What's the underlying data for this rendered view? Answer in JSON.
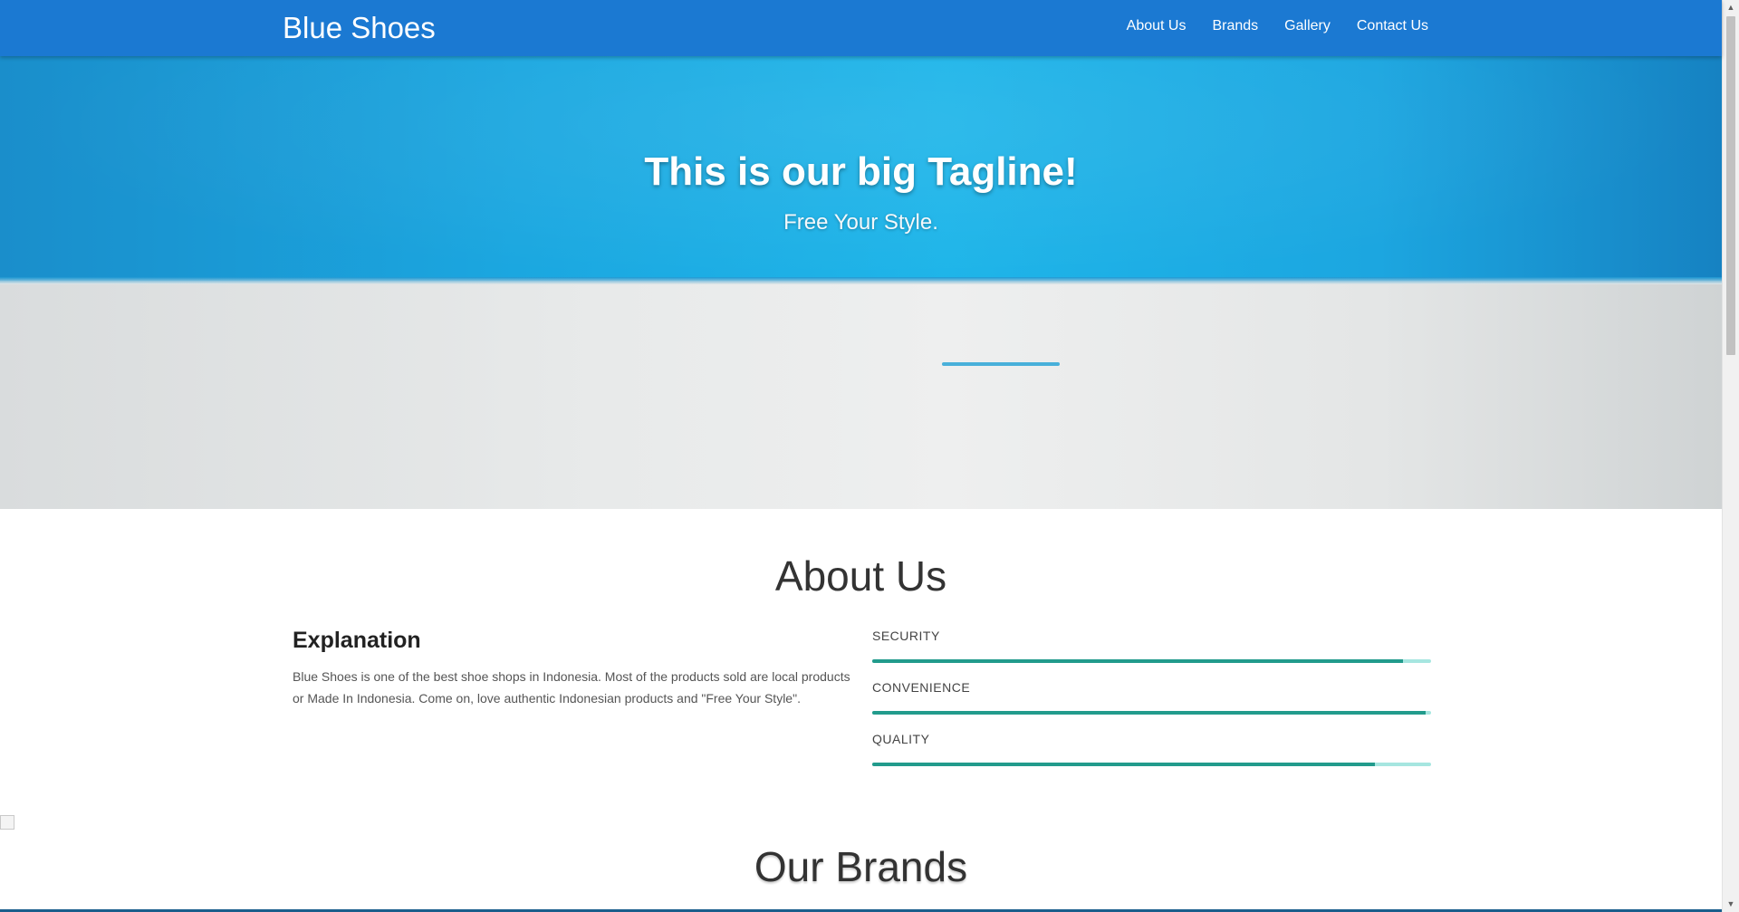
{
  "navbar": {
    "brand": "Blue Shoes",
    "links": [
      "About Us",
      "Brands",
      "Gallery",
      "Contact Us"
    ]
  },
  "hero": {
    "title": "This is our big Tagline!",
    "subtitle": "Free Your Style."
  },
  "about": {
    "title": "About Us",
    "heading": "Explanation",
    "text": "Blue Shoes is one of the best shoe shops in Indonesia. Most of the products sold are local products or Made In Indonesia. Come on, love authentic Indonesian products and \"Free Your Style\".",
    "skills": [
      {
        "label": "SECURITY",
        "percent": 95
      },
      {
        "label": "CONVENIENCE",
        "percent": 99
      },
      {
        "label": "QUALITY",
        "percent": 90
      }
    ]
  },
  "brands": {
    "title": "Our Brands"
  },
  "colors": {
    "navbar": "#1b79d2",
    "accent_fill": "#229b8c",
    "accent_track": "#a6e6e0"
  },
  "icons": {
    "broken_image": "broken-image-icon",
    "scroll_up": "scroll-up-arrow-icon",
    "scroll_down": "scroll-down-arrow-icon"
  }
}
